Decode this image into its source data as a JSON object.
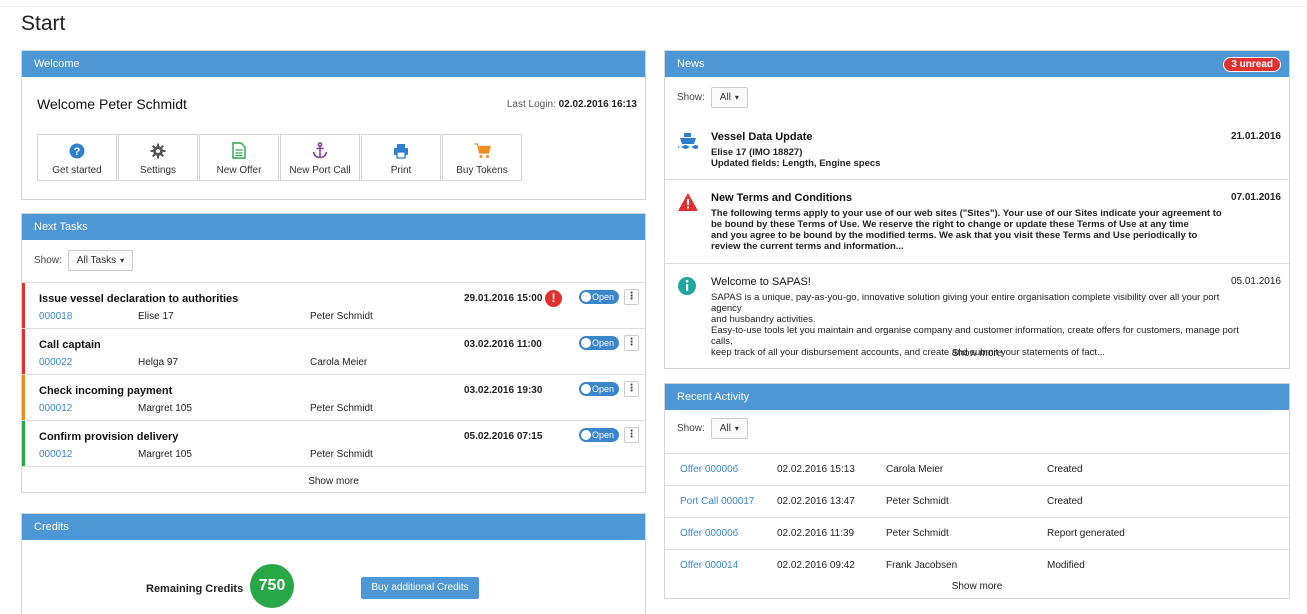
{
  "page": {
    "title": "Start"
  },
  "welcome": {
    "header": "Welcome",
    "greeting": "Welcome  Peter Schmidt",
    "last_login_label": "Last Login:",
    "last_login_value": "02.02.2016 16:13",
    "buttons": [
      {
        "label": "Get started",
        "icon": "question-icon",
        "color": "#2f7fd1"
      },
      {
        "label": "Settings",
        "icon": "gear-icon",
        "color": "#555555"
      },
      {
        "label": "New Offer",
        "icon": "document-icon",
        "color": "#27a745"
      },
      {
        "label": "New Port Call",
        "icon": "anchor-icon",
        "color": "#8e3fa7"
      },
      {
        "label": "Print",
        "icon": "printer-icon",
        "color": "#2f7fd1"
      },
      {
        "label": "Buy Tokens",
        "icon": "cart-icon",
        "color": "#f08a1c"
      }
    ]
  },
  "tasks": {
    "header": "Next Tasks",
    "show_label": "Show:",
    "filter_value": "All Tasks",
    "items": [
      {
        "title": "Issue vessel declaration to authorities",
        "id": "000018",
        "vessel": "Elise 17",
        "person": "Peter Schmidt",
        "date": "29.01.2016 15:00",
        "alert": "!",
        "status": "Open",
        "color": "#e03131"
      },
      {
        "title": "Call captain",
        "id": "000022",
        "vessel": "Helga 97",
        "person": "Carola Meier",
        "date": "03.02.2016 11:00",
        "status": "Open",
        "color": "#e03131"
      },
      {
        "title": "Check incoming payment",
        "id": "000012",
        "vessel": "Margret 105",
        "person": "Peter Schmidt",
        "date": "03.02.2016 19:30",
        "status": "Open",
        "color": "#f08a1c"
      },
      {
        "title": "Confirm provision delivery",
        "id": "000012",
        "vessel": "Margret 105",
        "person": "Peter Schmidt",
        "date": "05.02.2016 07:15",
        "status": "Open",
        "color": "#27a745"
      }
    ],
    "show_more": "Show more"
  },
  "credits": {
    "header": "Credits",
    "label": "Remaining Credits",
    "value": "750",
    "button": "Buy additional Credits"
  },
  "news": {
    "header": "News",
    "unread": "3 unread",
    "show_label": "Show:",
    "filter_value": "All",
    "items": [
      {
        "icon": "ship-icon",
        "title": "Vessel Data Update",
        "date": "21.01.2016",
        "lines": [
          "Elise 17 (IMO 18827)",
          "Updated fields: Length, Engine specs"
        ]
      },
      {
        "icon": "warning-icon",
        "title": "New Terms and Conditions",
        "date": "07.01.2016",
        "lines": [
          "The following terms apply to your use of our web sites (\"Sites\"). Your use of our Sites indicate your agreement to",
          "be bound by these Terms of Use. We reserve the right to change or update these Terms of Use at any time",
          "and you agree to be bound by the modified terms. We ask that you visit these Terms and Use periodically to",
          "review the current terms and information..."
        ]
      },
      {
        "icon": "info-icon",
        "title": "Welcome to SAPAS!",
        "date": "05.01.2016",
        "lines": [
          "SAPAS is a unique, pay-as-you-go, innovative solution giving your entire organisation complete visibility over all your port agency",
          "and husbandry activities.",
          "Easy-to-use tools let you maintain and organise company and customer information, create offers for customers, manage port calls,",
          "keep track of all your disbursement accounts, and create and submit your statements of fact..."
        ]
      }
    ],
    "show_more": "Show more"
  },
  "activity": {
    "header": "Recent Activity",
    "show_label": "Show:",
    "filter_value": "All",
    "rows": [
      {
        "link": "Offer 000006",
        "date": "02.02.2016 15:13",
        "person": "Carola Meier",
        "action": "Created"
      },
      {
        "link": "Port Call 000017",
        "date": "02.02.2016 13:47",
        "person": "Peter Schmidt",
        "action": "Created"
      },
      {
        "link": "Offer 000006",
        "date": "02.02.2016 11:39",
        "person": "Peter Schmidt",
        "action": "Report generated"
      },
      {
        "link": "Offer 000014",
        "date": "02.02.2016 09:42",
        "person": "Frank Jacobsen",
        "action": "Modified"
      }
    ],
    "show_more": "Show more"
  }
}
